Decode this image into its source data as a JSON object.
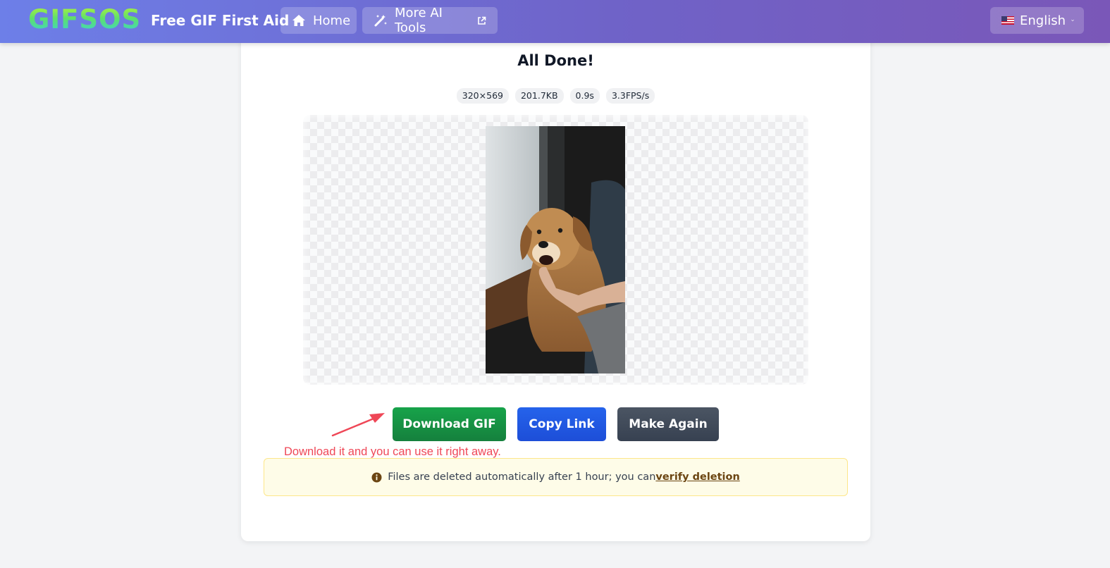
{
  "header": {
    "logo": "GIFSOS",
    "tagline": "Free GIF First Aid",
    "nav": {
      "home_label": "Home",
      "tools_label": "More AI Tools"
    },
    "language_label": "English"
  },
  "result": {
    "title": "All Done!",
    "stats": {
      "dimensions": "320×569",
      "size": "201.7KB",
      "duration": "0.9s",
      "fps": "3.3FPS/s"
    }
  },
  "actions": {
    "download_label": "Download GIF",
    "copy_label": "Copy Link",
    "again_label": "Make Again"
  },
  "annotation": {
    "hint": "Download it and you can use it right away.",
    "color": "#ef4757"
  },
  "notice": {
    "text": "Files are deleted automatically after 1 hour; you can",
    "link_text": "verify deletion"
  },
  "colors": {
    "download": "#16a34a",
    "copy": "#2563eb",
    "again": "#4b5563",
    "header_start": "#6d7fe8",
    "header_end": "#7a57b8"
  }
}
